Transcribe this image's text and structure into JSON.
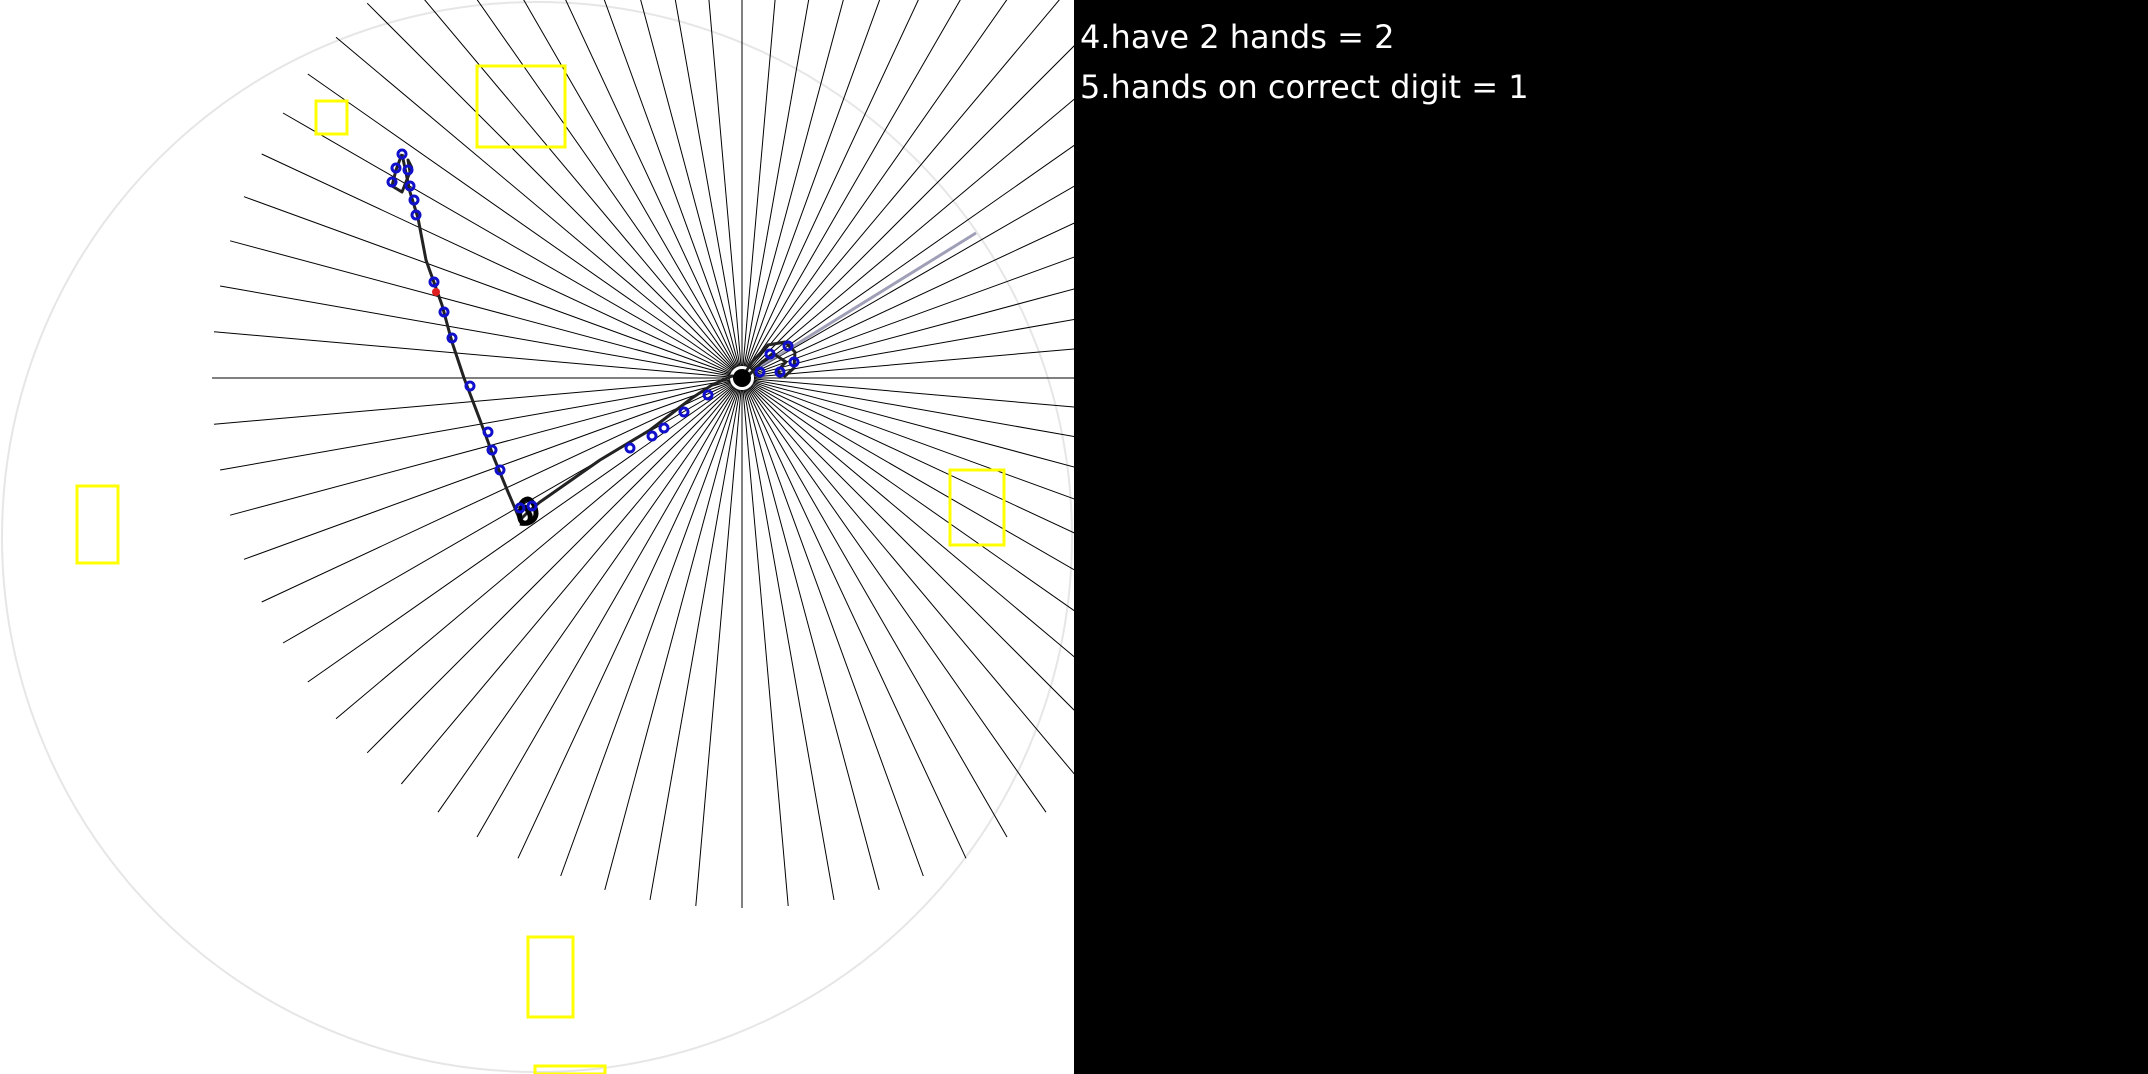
{
  "results": {
    "items": [
      {
        "label": "4.have 2 hands = 2"
      },
      {
        "label": "5.hands on correct digit = 1"
      }
    ]
  },
  "colors": {
    "canvas_background": "#ffffff",
    "panel_background": "#000000",
    "result_text": "#ffffff",
    "digit_box": "#ffff00",
    "ray": "#000000",
    "stroke": "#222222",
    "sample_point": "#1010cc",
    "highlight_point": "#e02020",
    "clock_outline": "#e6e6e6"
  },
  "diagram": {
    "ray_count": 72,
    "digit_boxes": 6,
    "hands": 2
  }
}
